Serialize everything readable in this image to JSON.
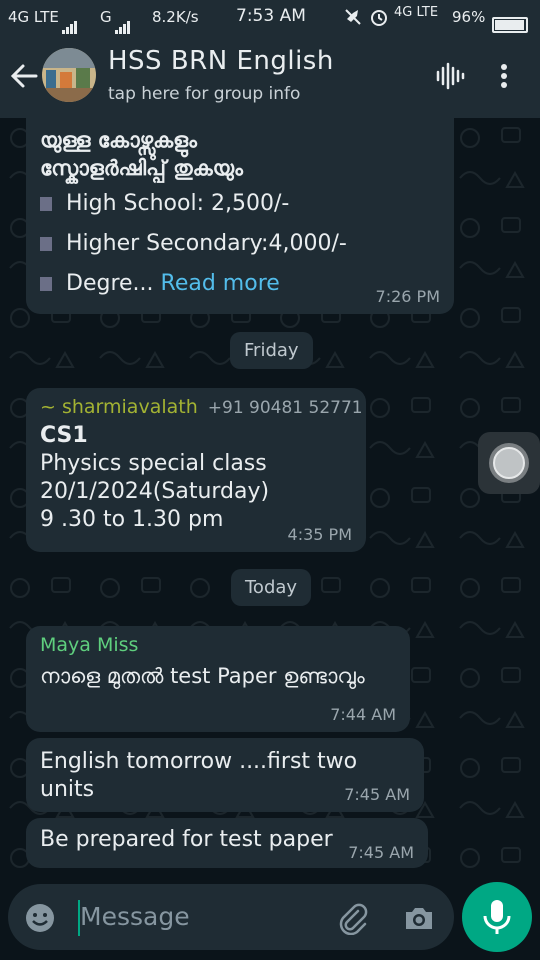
{
  "status": {
    "net1": "4G LTE",
    "net2": "G",
    "speed": "8.2K/s",
    "time": "7:53 AM",
    "net3": "4G LTE",
    "battery": "96%"
  },
  "header": {
    "title": "HSS BRN English",
    "subtitle": "tap here for group info"
  },
  "messages": {
    "m1": {
      "line1": "യുള്ള കോഴ്സുകളും",
      "line2": "സ്കോളർഷിപ്പ് തുകയും",
      "bullet1": "High School: 2,500/-",
      "bullet2": "Higher Secondary:4,000/-",
      "bullet3": "Degre...",
      "read_more": "Read more",
      "time": "7:26 PM"
    },
    "day1": "Friday",
    "m2": {
      "sender": "~ sharmiavalath",
      "phone": "+91 90481 52771",
      "line1": "CS1",
      "line2": "Physics special class",
      "line3": "20/1/2024(Saturday)",
      "line4": "9 .30 to 1.30 pm",
      "time": "4:35 PM"
    },
    "day2": "Today",
    "m3": {
      "sender": "Maya Miss",
      "text": "നാളെ മുതൽ test Paper ഉണ്ടാവും",
      "time": "7:44 AM"
    },
    "m4": {
      "text": "English tomorrow ....first two units",
      "time": "7:45 AM"
    },
    "m5": {
      "text": "Be prepared for test paper",
      "time": "7:45 AM"
    }
  },
  "input": {
    "placeholder": "Message"
  },
  "colors": {
    "accent": "#00a884",
    "sender_sharmi": "#a3b333",
    "sender_maya": "#5fcf7e",
    "link": "#53bdeb",
    "bubble": "#1f2c34",
    "background": "#0b141a"
  },
  "icons": [
    "back-arrow-icon",
    "voice-call-icon",
    "more-vert-icon",
    "emoji-icon",
    "attach-icon",
    "camera-icon",
    "mic-icon"
  ]
}
